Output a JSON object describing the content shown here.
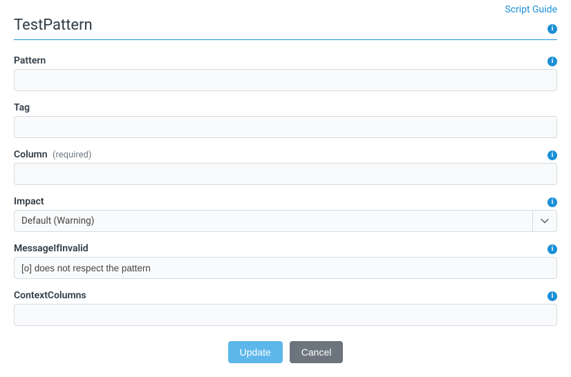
{
  "header": {
    "script_guide_label": "Script Guide",
    "title": "TestPattern"
  },
  "fields": {
    "pattern": {
      "label": "Pattern",
      "value": ""
    },
    "tag": {
      "label": "Tag",
      "value": ""
    },
    "column": {
      "label": "Column",
      "required_text": "(required)",
      "value": ""
    },
    "impact": {
      "label": "Impact",
      "selected": "Default (Warning)"
    },
    "message_if_invalid": {
      "label": "MessageIfInvalid",
      "value": "[o] does not respect the pattern"
    },
    "context_columns": {
      "label": "ContextColumns",
      "value": ""
    }
  },
  "buttons": {
    "update": "Update",
    "cancel": "Cancel"
  }
}
